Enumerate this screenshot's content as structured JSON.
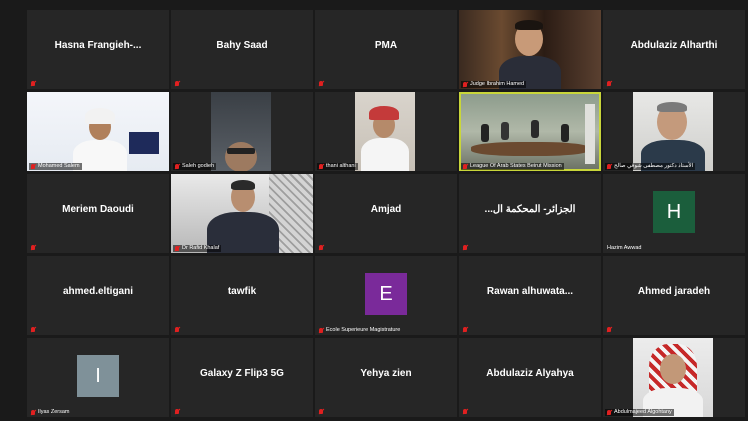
{
  "tiles": [
    {
      "name": "Hasna  Frangieh-...",
      "type": "name"
    },
    {
      "name": "Bahy Saad",
      "type": "name"
    },
    {
      "name": "PMA",
      "type": "name"
    },
    {
      "label": "Judge Ibrahim Hamed",
      "type": "video"
    },
    {
      "name": "Abdulaziz Alharthi",
      "type": "name"
    },
    {
      "label": "Mohamed Salem",
      "type": "video"
    },
    {
      "label": "Saleh godieh",
      "type": "video"
    },
    {
      "label": "thani althani",
      "type": "video"
    },
    {
      "label": "League Of Arab States Beirut Mission",
      "type": "video",
      "active": true
    },
    {
      "label": "الأستاذ دكتور مصطفى شوقي صالح",
      "type": "video"
    },
    {
      "name": "Meriem Daoudi",
      "type": "name"
    },
    {
      "label": "Dr Rafid Khalaf",
      "type": "video"
    },
    {
      "name": "Amjad",
      "type": "name"
    },
    {
      "name": "...الجزائر- المحكمة ال",
      "type": "name"
    },
    {
      "label": "Hazim Awwad",
      "type": "avatar",
      "initial": "H",
      "color": "#1b5e3c"
    },
    {
      "name": "ahmed.eltigani",
      "type": "name"
    },
    {
      "name": "tawfik",
      "type": "name"
    },
    {
      "label": "Ecole Superieure Magistrature",
      "type": "avatar",
      "initial": "E",
      "color": "#7a2a9a"
    },
    {
      "name": "Rawan  alhuwata...",
      "type": "name"
    },
    {
      "name": "Ahmed jaradeh",
      "type": "name"
    },
    {
      "label": "Ilyas Zersam",
      "type": "avatar",
      "initial": "I",
      "color": "#7f9199"
    },
    {
      "name": "Galaxy Z Flip3 5G",
      "type": "name"
    },
    {
      "name": "Yehya zien",
      "type": "name"
    },
    {
      "name": "Abdulaziz Alyahya",
      "type": "name"
    },
    {
      "label": "Abdulmajeed Algohtany",
      "type": "video"
    }
  ]
}
